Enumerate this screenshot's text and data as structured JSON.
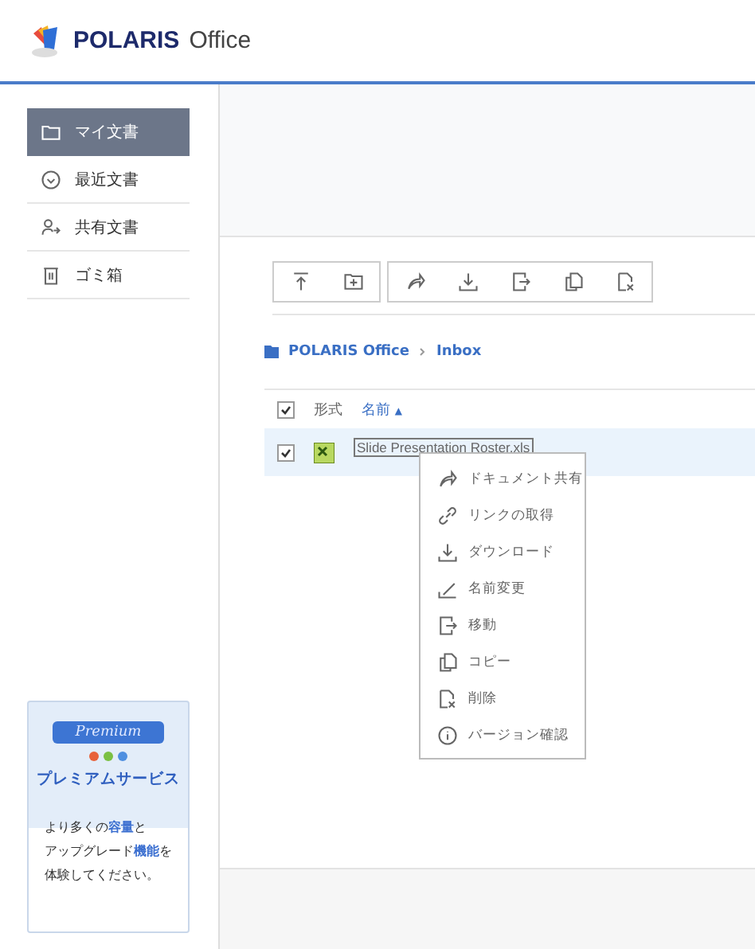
{
  "header": {
    "logo_brand": "POLARIS",
    "logo_product": "Office"
  },
  "sidebar": {
    "items": [
      {
        "label": "マイ文書",
        "selected": true
      },
      {
        "label": "最近文書",
        "selected": false
      },
      {
        "label": "共有文書",
        "selected": false
      },
      {
        "label": "ゴミ箱",
        "selected": false
      }
    ]
  },
  "promo": {
    "ribbon": "Premium",
    "title": "プレミアムサービス",
    "lines": [
      "より多くの**容量**と",
      "アップグレード**機能**を",
      "体験してください。"
    ]
  },
  "breadcrumb": [
    "POLARIS Office",
    "Inbox"
  ],
  "table": {
    "header": {
      "checked": true,
      "type_label": "形式",
      "name_label": "名前",
      "sort_icon": "▲"
    },
    "rows": [
      {
        "checked": true,
        "name": "Slide Presentation Roster.xls",
        "selected": true
      }
    ]
  },
  "context_menu": [
    {
      "label": "ドキュメント共有"
    },
    {
      "label": "リンクの取得"
    },
    {
      "label": "ダウンロード"
    },
    {
      "label": "名前変更"
    },
    {
      "label": "移動"
    },
    {
      "label": "コピー"
    },
    {
      "label": "削除"
    },
    {
      "label": "バージョン確認"
    }
  ]
}
